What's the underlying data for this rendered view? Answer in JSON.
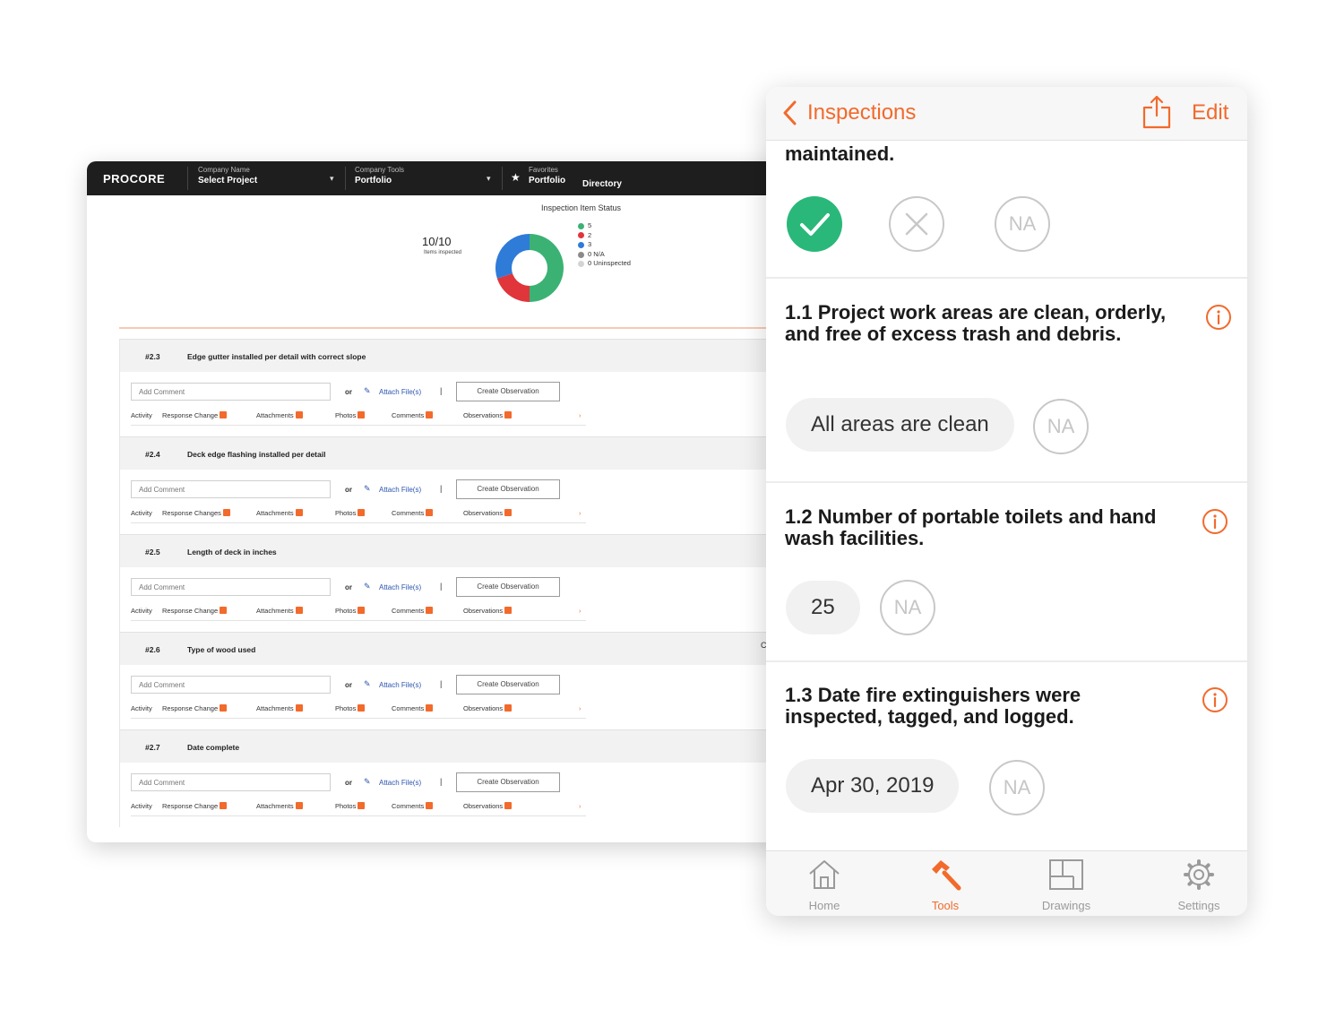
{
  "desktop": {
    "logo": "PROCORE",
    "company": {
      "label": "Company Name",
      "value": "Select Project"
    },
    "tools": {
      "label": "Company Tools",
      "value": "Portfolio"
    },
    "favorites": {
      "label": "Favorites",
      "items": [
        "Portfolio",
        "Directory"
      ]
    },
    "status_title": "Inspection Item Status",
    "count": "10/10",
    "count_sub": "Items inspected",
    "legend": [
      {
        "label": "5",
        "color": "#3bb273"
      },
      {
        "label": "2",
        "color": "#e0353b"
      },
      {
        "label": "3",
        "color": "#2f7bd8"
      },
      {
        "label": "0 N/A",
        "color": "#8a8a8a"
      },
      {
        "label": "0 Uninspected",
        "color": "#d4d4d4"
      }
    ],
    "donut": {
      "segments": [
        {
          "value": 5,
          "color": "#3bb273"
        },
        {
          "value": 2,
          "color": "#e0353b"
        },
        {
          "value": 3,
          "color": "#2f7bd8"
        }
      ]
    },
    "comment_placeholder": "Add Comment",
    "or_label": "or",
    "attach_label": "Attach File(s)",
    "create_label": "Create Observation",
    "edge_char": "C",
    "items": [
      {
        "num": "#2.3",
        "title": "Edge gutter installed per detail with correct slope",
        "activity": {
          "label": "Activity",
          "response": "Response Change",
          "attachments": "Attachments",
          "photos": "Photos",
          "comments": "Comments",
          "observations": "Observations"
        }
      },
      {
        "num": "#2.4",
        "title": "Deck edge flashing installed per detail",
        "activity": {
          "label": "Activity",
          "response": "Response Changes",
          "attachments": "Attachments",
          "photos": "Photos",
          "comments": "Comments",
          "observations": "Observations"
        }
      },
      {
        "num": "#2.5",
        "title": "Length of deck in inches",
        "activity": {
          "label": "Activity",
          "response": "Response Change",
          "attachments": "Attachments",
          "photos": "Photos",
          "comments": "Comments",
          "observations": "Observations"
        }
      },
      {
        "num": "#2.6",
        "title": "Type of wood used",
        "activity": {
          "label": "Activity",
          "response": "Response Change",
          "attachments": "Attachments",
          "photos": "Photos",
          "comments": "Comments",
          "observations": "Observations"
        }
      },
      {
        "num": "#2.7",
        "title": "Date complete",
        "activity": {
          "label": "Activity",
          "response": "Response Change",
          "attachments": "Attachments",
          "photos": "Photos",
          "comments": "Comments",
          "observations": "Observations"
        }
      }
    ]
  },
  "mobile": {
    "back_label": "Inspections",
    "edit_label": "Edit",
    "partial_text": "maintained.",
    "na_label": "NA",
    "questions": [
      {
        "title": "1.1 Project work areas are clean, orderly, and free of excess trash and debris.",
        "answer": "All areas are clean"
      },
      {
        "title": "1.2 Number of portable toilets and hand wash facilities.",
        "answer": "25"
      },
      {
        "title": "1.3  Date fire extinguishers were inspected, tagged, and logged.",
        "answer": "Apr 30, 2019"
      }
    ],
    "tabs": [
      {
        "label": "Home",
        "icon": "home-icon"
      },
      {
        "label": "Tools",
        "icon": "hammer-icon"
      },
      {
        "label": "Drawings",
        "icon": "drawings-icon"
      },
      {
        "label": "Settings",
        "icon": "gear-icon"
      }
    ],
    "active_tab": "Tools",
    "accent": "#f26a2c",
    "success": "#29b879"
  }
}
